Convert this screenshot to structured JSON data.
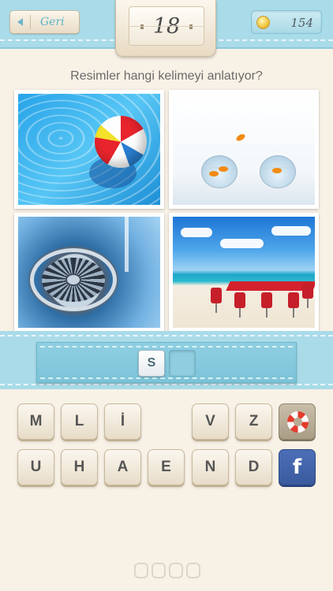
{
  "header": {
    "back_label": "Geri",
    "level": "18",
    "coins": "154"
  },
  "question": "Resimler hangi kelimeyi anlatıyor?",
  "answer": {
    "letters": [
      "S",
      ""
    ]
  },
  "keyboard": {
    "row1": [
      "M",
      "L",
      "İ",
      "",
      "V",
      "Z"
    ],
    "row2": [
      "U",
      "H",
      "A",
      "E",
      "N",
      "D"
    ],
    "facebook_label": "f"
  },
  "colors": {
    "header": "#a9dbe8",
    "background": "#f8f1e6",
    "facebook": "#3b5998",
    "help": "#b4a992"
  }
}
